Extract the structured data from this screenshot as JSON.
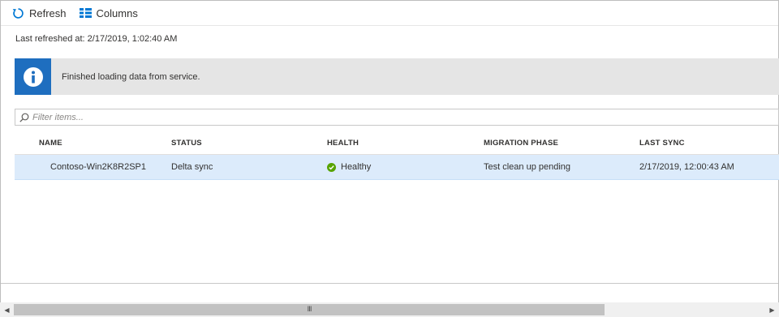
{
  "toolbar": {
    "refresh_label": "Refresh",
    "columns_label": "Columns"
  },
  "status": {
    "last_refreshed": "Last refreshed at: 2/17/2019, 1:02:40 AM"
  },
  "banner": {
    "icon": "info-icon",
    "message": "Finished loading data from service."
  },
  "filter": {
    "placeholder": "Filter items...",
    "value": ""
  },
  "table": {
    "columns": [
      "NAME",
      "STATUS",
      "HEALTH",
      "MIGRATION PHASE",
      "LAST SYNC"
    ],
    "rows": [
      {
        "name": "Contoso-Win2K8R2SP1",
        "status": "Delta sync",
        "health": "Healthy",
        "migration_phase": "Test clean up pending",
        "last_sync": "2/17/2019, 12:00:43 AM"
      }
    ]
  },
  "colors": {
    "accent": "#0078d4",
    "banner_bg": "#e5e5e5",
    "info_icon_bg": "#1e6ebf",
    "selected_row": "#dcebfb",
    "healthy_green": "#57a300"
  },
  "scrollbar": {
    "grip": "III"
  }
}
